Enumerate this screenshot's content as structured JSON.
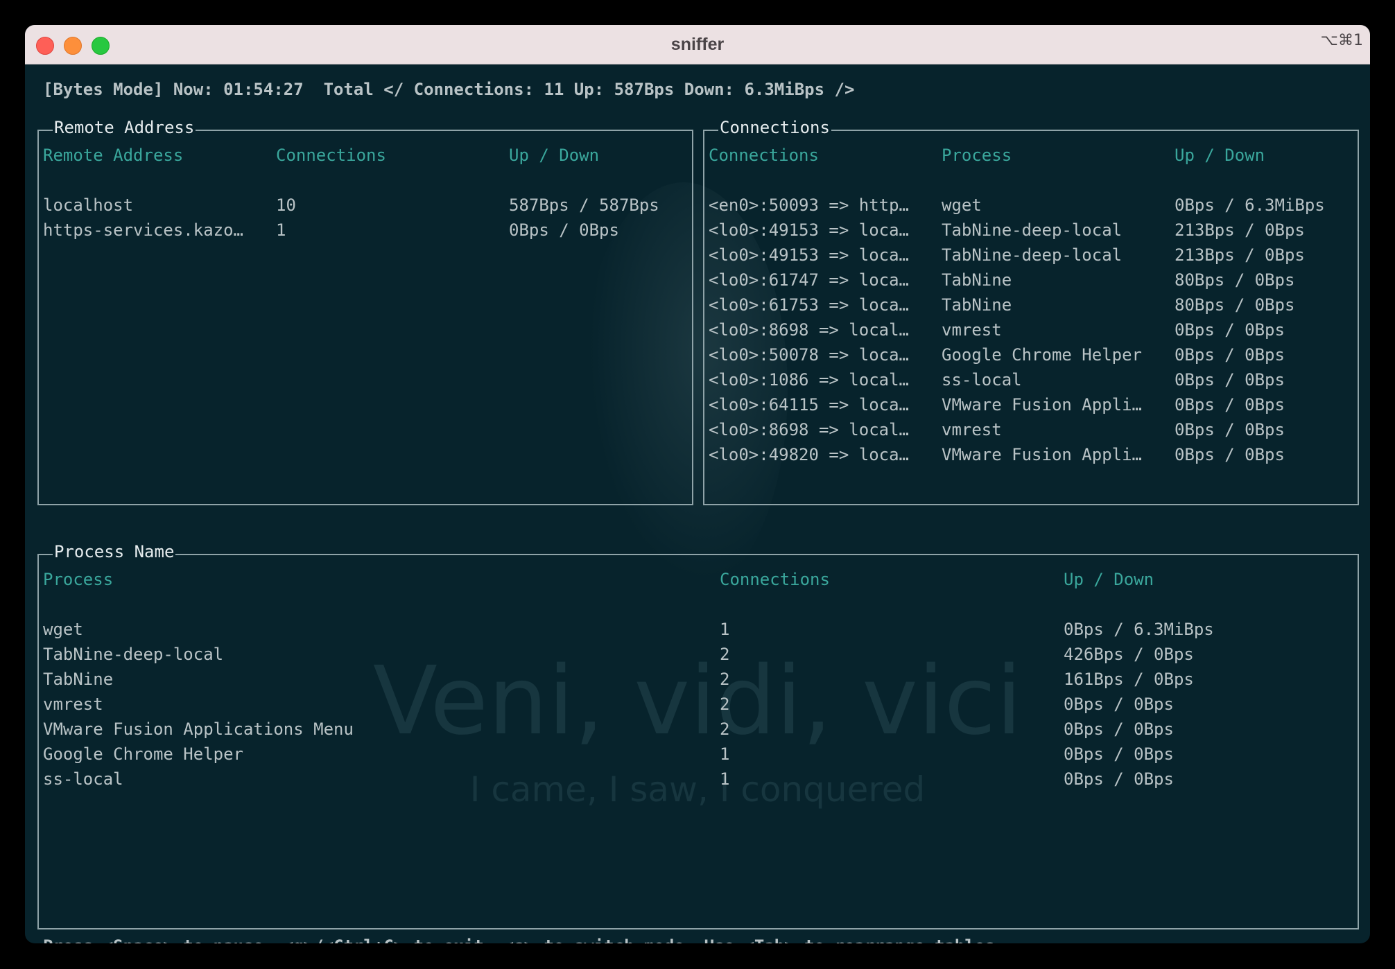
{
  "window": {
    "title": "sniffer",
    "shortcut": "⌥⌘1"
  },
  "status_line": "[Bytes Mode] Now: 01:54:27  Total </ Connections: 11 Up: 587Bps Down: 6.3MiBps />",
  "footer_help": "Press <Space> to pause, <q>/<Ctrl+C> to exit, <s> to switch mode. Use <Tab> to rearrange tables",
  "watermark": {
    "main": "Veni, vidi, vici",
    "sub": "I came, I saw, I conquered"
  },
  "remote_panel": {
    "title": "Remote Address",
    "headers": [
      "Remote Address",
      "Connections",
      "Up / Down"
    ],
    "rows": [
      [
        "localhost",
        "10",
        "587Bps / 587Bps"
      ],
      [
        "https-services.kazo…",
        "1",
        "0Bps / 0Bps"
      ]
    ]
  },
  "connections_panel": {
    "title": "Connections",
    "headers": [
      "Connections",
      "Process",
      "Up / Down"
    ],
    "rows": [
      [
        "<en0>:50093 => http…",
        "wget",
        "0Bps / 6.3MiBps"
      ],
      [
        "<lo0>:49153 => loca…",
        "TabNine-deep-local",
        "213Bps / 0Bps"
      ],
      [
        "<lo0>:49153 => loca…",
        "TabNine-deep-local",
        "213Bps / 0Bps"
      ],
      [
        "<lo0>:61747 => loca…",
        "TabNine",
        "80Bps / 0Bps"
      ],
      [
        "<lo0>:61753 => loca…",
        "TabNine",
        "80Bps / 0Bps"
      ],
      [
        "<lo0>:8698 => local…",
        "vmrest",
        "0Bps / 0Bps"
      ],
      [
        "<lo0>:50078 => loca…",
        "Google Chrome Helper",
        "0Bps / 0Bps"
      ],
      [
        "<lo0>:1086 => local…",
        "ss-local",
        "0Bps / 0Bps"
      ],
      [
        "<lo0>:64115 => loca…",
        "VMware Fusion Appli…",
        "0Bps / 0Bps"
      ],
      [
        "<lo0>:8698 => local…",
        "vmrest",
        "0Bps / 0Bps"
      ],
      [
        "<lo0>:49820 => loca…",
        "VMware Fusion Appli…",
        "0Bps / 0Bps"
      ]
    ]
  },
  "process_panel": {
    "title": "Process Name",
    "headers": [
      "Process",
      "Connections",
      "Up / Down"
    ],
    "rows": [
      [
        "wget",
        "1",
        "0Bps / 6.3MiBps"
      ],
      [
        "TabNine-deep-local",
        "2",
        "426Bps / 0Bps"
      ],
      [
        "TabNine",
        "2",
        "161Bps / 0Bps"
      ],
      [
        "vmrest",
        "2",
        "0Bps / 0Bps"
      ],
      [
        "VMware Fusion Applications Menu",
        "2",
        "0Bps / 0Bps"
      ],
      [
        "Google Chrome Helper",
        "1",
        "0Bps / 0Bps"
      ],
      [
        "ss-local",
        "1",
        "0Bps / 0Bps"
      ]
    ]
  }
}
